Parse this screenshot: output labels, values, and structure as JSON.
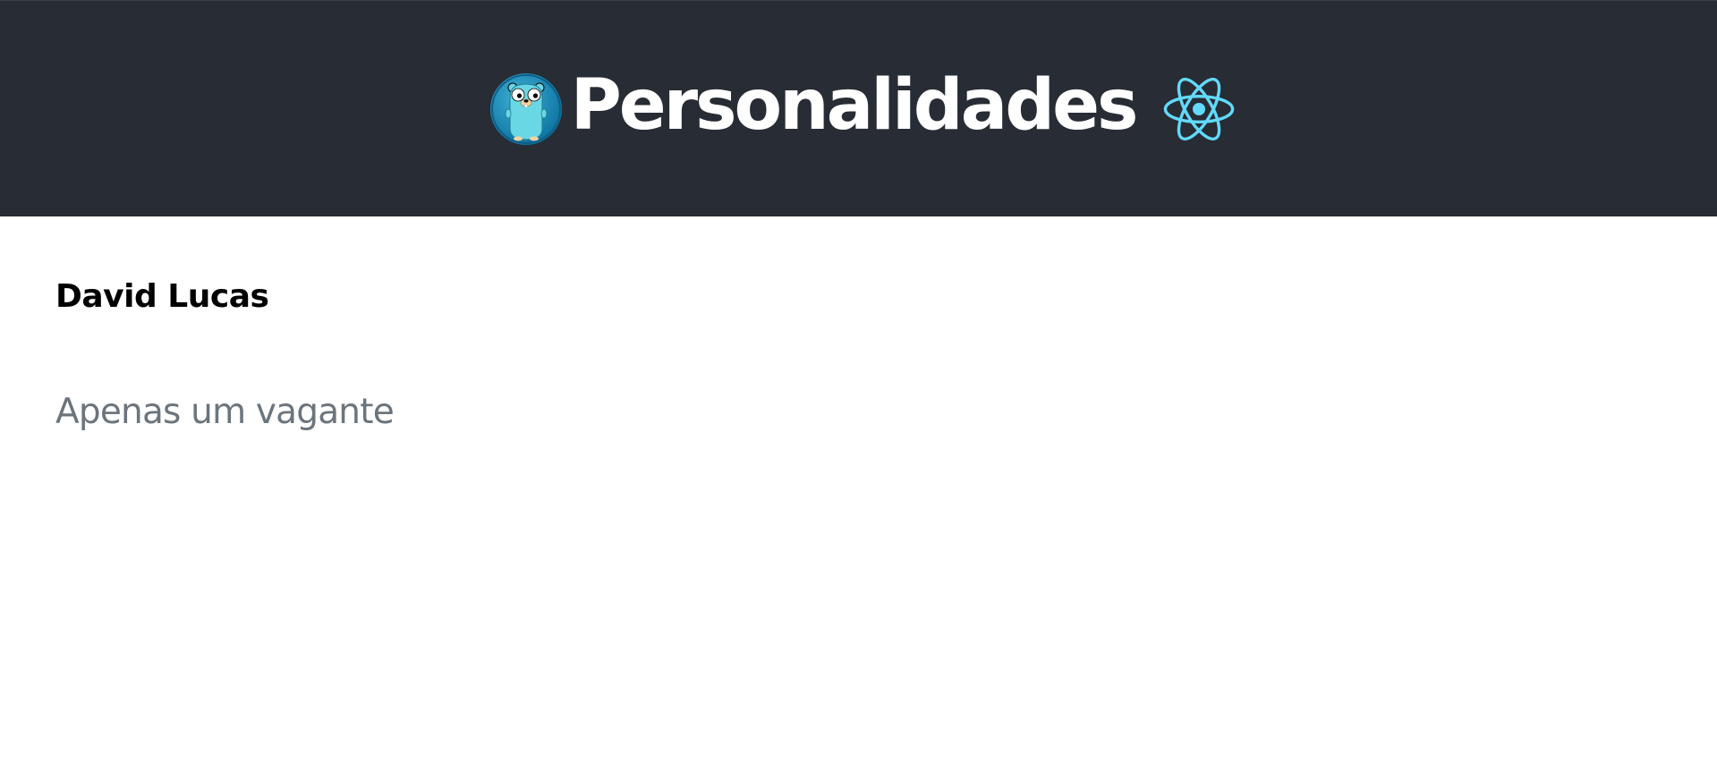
{
  "header": {
    "title": "Personalidades",
    "left_logo_icon": "go-gopher-icon",
    "right_logo_icon": "react-atom-icon",
    "background_color": "#282c34",
    "accent_color": "#61dafb"
  },
  "profile": {
    "name": "David Lucas",
    "bio": "Apenas um vagante"
  }
}
